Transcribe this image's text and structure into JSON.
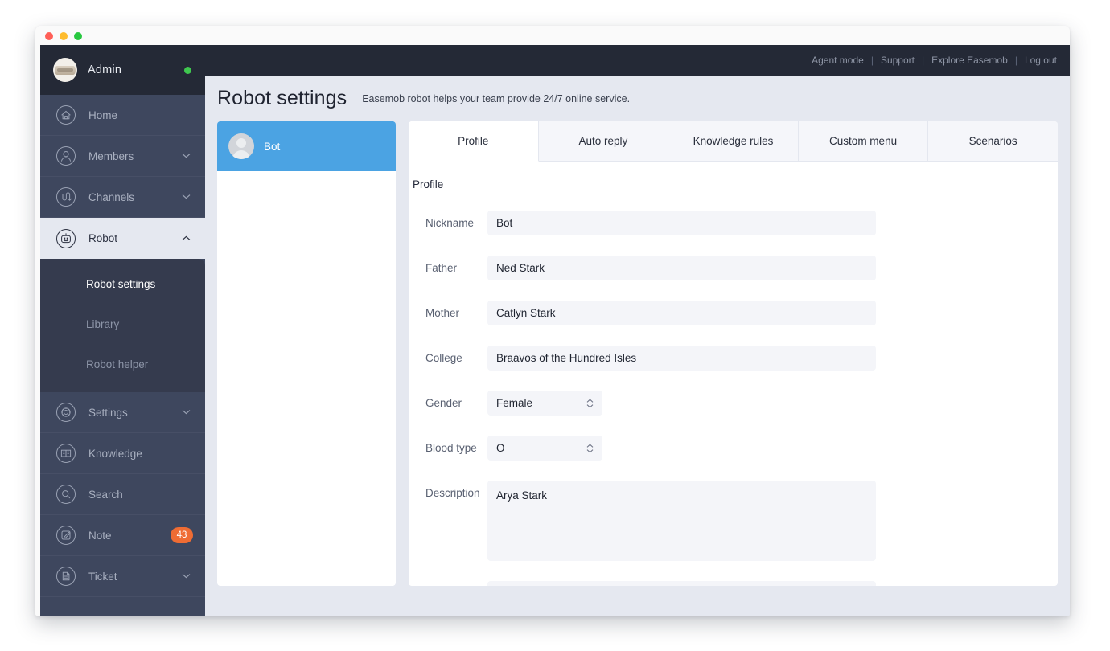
{
  "window": {
    "traffic_lights": [
      "close",
      "minimize",
      "zoom"
    ]
  },
  "sidebar": {
    "account": {
      "name": "Admin",
      "status": "online"
    },
    "items": [
      {
        "label": "Home",
        "icon": "home-icon",
        "expandable": false,
        "state": "default"
      },
      {
        "label": "Members",
        "icon": "members-icon",
        "expandable": true,
        "state": "default"
      },
      {
        "label": "Channels",
        "icon": "channels-icon",
        "expandable": true,
        "state": "default"
      },
      {
        "label": "Robot",
        "icon": "robot-icon",
        "expandable": true,
        "state": "expanded"
      },
      {
        "label": "Settings",
        "icon": "gear-icon",
        "expandable": true,
        "state": "default"
      },
      {
        "label": "Knowledge",
        "icon": "book-icon",
        "expandable": false,
        "state": "default"
      },
      {
        "label": "Search",
        "icon": "search-icon",
        "expandable": false,
        "state": "default"
      },
      {
        "label": "Note",
        "icon": "note-icon",
        "expandable": false,
        "state": "default",
        "badge": "43"
      },
      {
        "label": "Ticket",
        "icon": "ticket-icon",
        "expandable": true,
        "state": "default"
      }
    ],
    "submenu": [
      {
        "label": "Robot settings",
        "active": true
      },
      {
        "label": "Library",
        "active": false
      },
      {
        "label": "Robot helper",
        "active": false
      }
    ]
  },
  "topbar": {
    "links": [
      "Agent mode",
      "Support",
      "Explore Easemob",
      "Log out"
    ],
    "separator": "|"
  },
  "page": {
    "title": "Robot settings",
    "subtitle": "Easemob robot helps your team provide 24/7 online service."
  },
  "bot_list": [
    {
      "name": "Bot",
      "selected": true
    }
  ],
  "tabs": [
    {
      "label": "Profile",
      "active": true
    },
    {
      "label": "Auto reply",
      "active": false
    },
    {
      "label": "Knowledge rules",
      "active": false
    },
    {
      "label": "Custom menu",
      "active": false
    },
    {
      "label": "Scenarios",
      "active": false
    }
  ],
  "form": {
    "section_title": "Profile",
    "fields": [
      {
        "label": "Nickname",
        "type": "text",
        "value": "Bot"
      },
      {
        "label": "Father",
        "type": "text",
        "value": "Ned Stark"
      },
      {
        "label": "Mother",
        "type": "text",
        "value": "Catlyn Stark"
      },
      {
        "label": "College",
        "type": "text",
        "value": "Braavos of the Hundred Isles"
      },
      {
        "label": "Gender",
        "type": "select",
        "value": "Female"
      },
      {
        "label": "Blood type",
        "type": "select",
        "value": "O"
      },
      {
        "label": "Description",
        "type": "textarea",
        "value": "Arya Stark"
      }
    ]
  },
  "colors": {
    "sidebar": "#3e475e",
    "sidebar_dark": "#242936",
    "submenu": "#353b4e",
    "page_bg": "#e5e8f0",
    "accent_blue": "#4ba3e3",
    "badge_orange": "#ef6c33",
    "status_green": "#3fc74f",
    "field_bg": "#f4f5f9"
  }
}
